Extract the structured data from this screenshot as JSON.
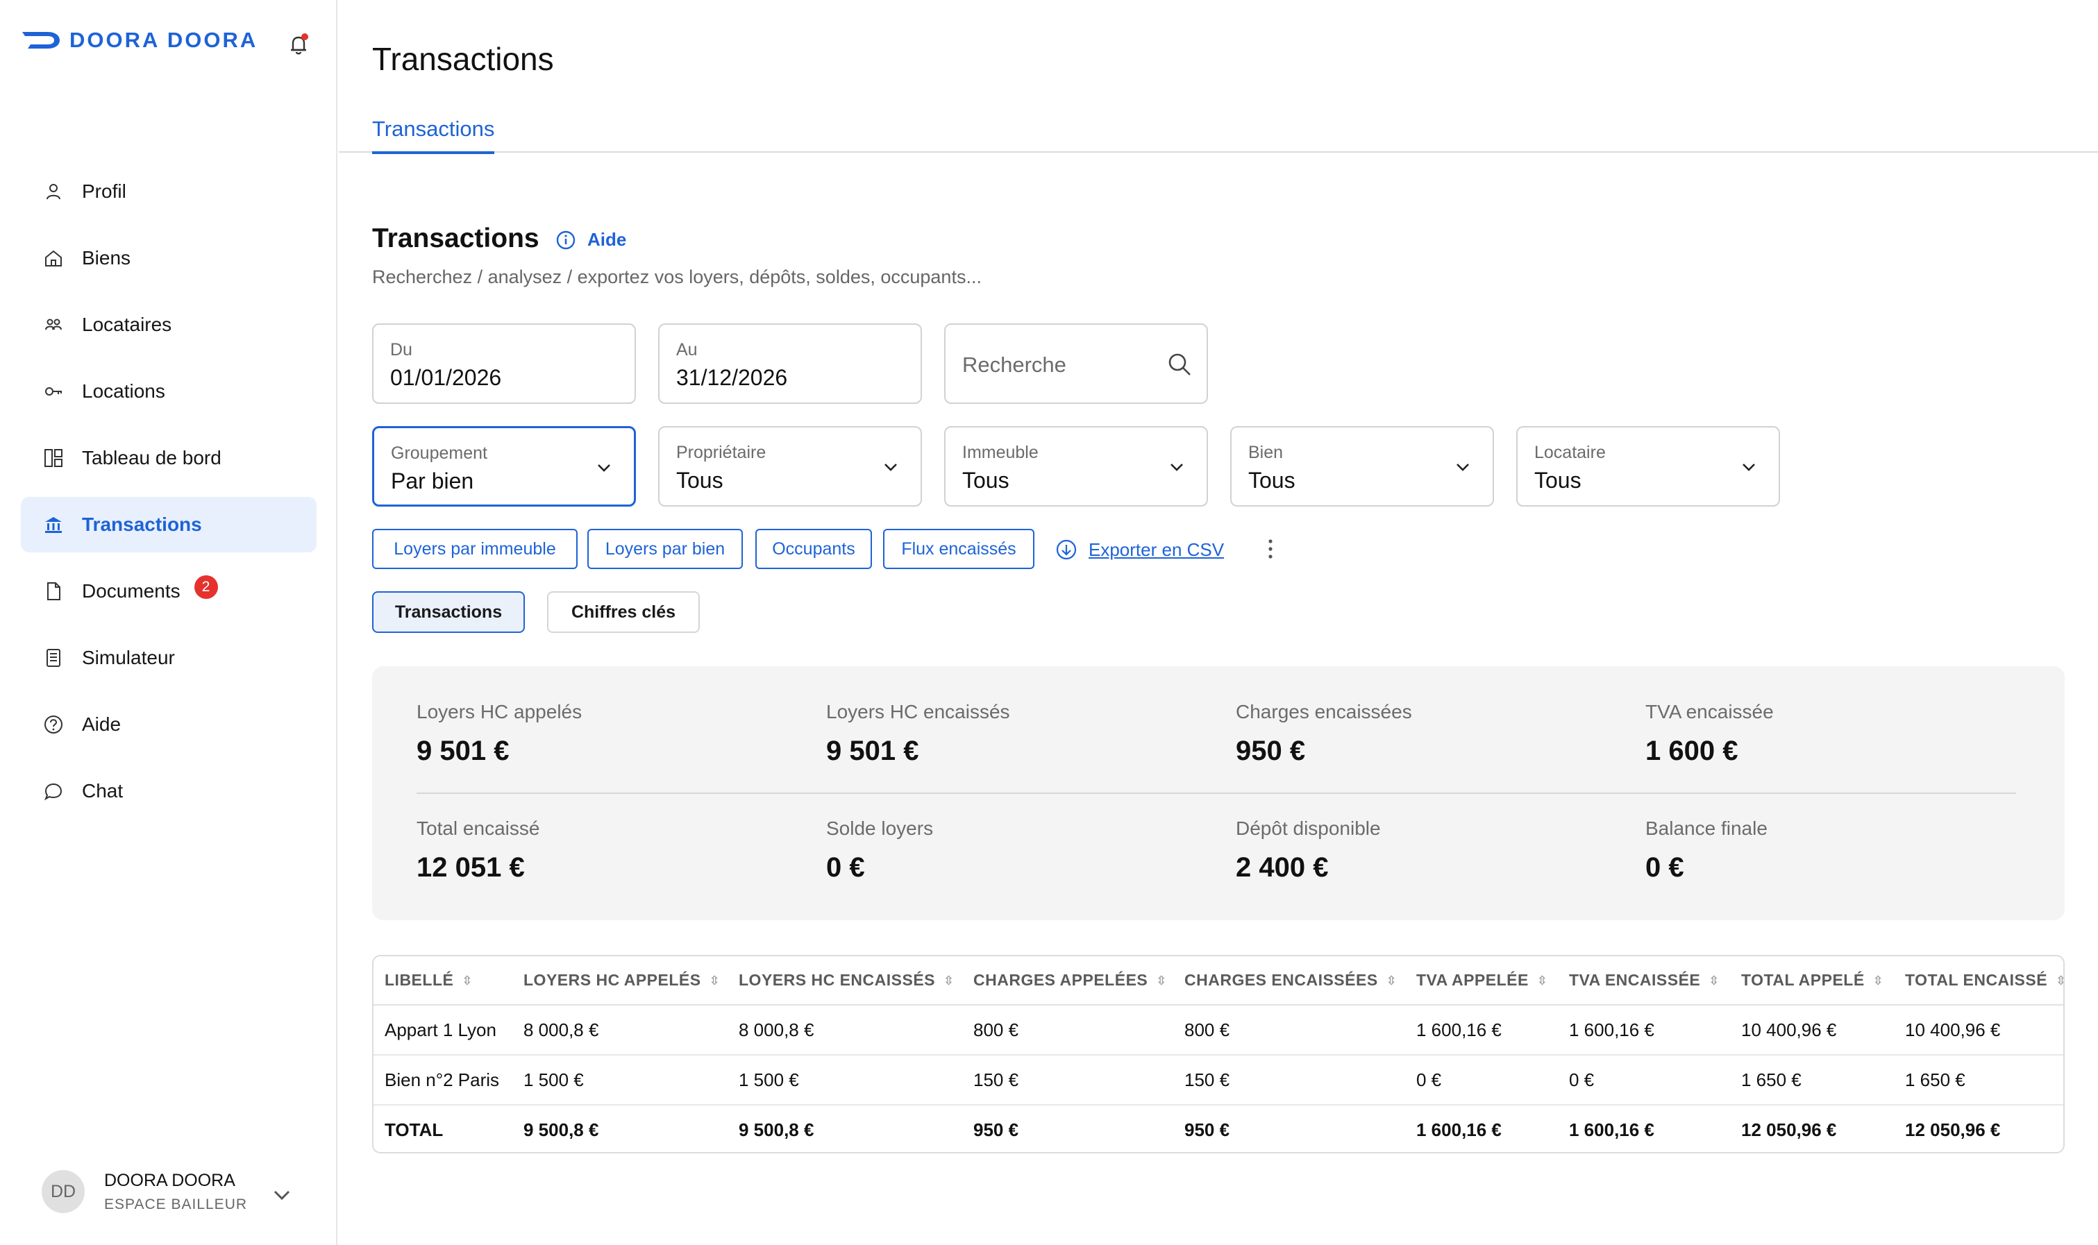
{
  "brand": {
    "name": "DOORA DOORA",
    "color": "#1e63d6"
  },
  "sidebar": {
    "items": [
      {
        "label": "Profil",
        "icon": "user-icon"
      },
      {
        "label": "Biens",
        "icon": "home-icon"
      },
      {
        "label": "Locataires",
        "icon": "people-icon"
      },
      {
        "label": "Locations",
        "icon": "key-icon"
      },
      {
        "label": "Tableau de bord",
        "icon": "dashboard-icon"
      },
      {
        "label": "Transactions",
        "icon": "bank-icon",
        "active": true
      },
      {
        "label": "Documents",
        "icon": "document-icon",
        "badge": "2"
      },
      {
        "label": "Simulateur",
        "icon": "calculator-icon"
      },
      {
        "label": "Aide",
        "icon": "help-icon"
      },
      {
        "label": "Chat",
        "icon": "chat-icon"
      }
    ],
    "user": {
      "initials": "DD",
      "name": "DOORA DOORA",
      "role": "ESPACE BAILLEUR"
    }
  },
  "header": {
    "title": "Transactions",
    "tab": "Transactions"
  },
  "section": {
    "title": "Transactions",
    "help_label": "Aide",
    "subtitle": "Recherchez / analysez / exportez vos loyers, dépôts, soldes, occupants..."
  },
  "filters": {
    "from": {
      "label": "Du",
      "value": "01/01/2026"
    },
    "to": {
      "label": "Au",
      "value": "31/12/2026"
    },
    "search": {
      "placeholder": "Recherche"
    },
    "grouping": {
      "label": "Groupement",
      "value": "Par bien"
    },
    "owner": {
      "label": "Propriétaire",
      "value": "Tous"
    },
    "building": {
      "label": "Immeuble",
      "value": "Tous"
    },
    "property": {
      "label": "Bien",
      "value": "Tous"
    },
    "tenant": {
      "label": "Locataire",
      "value": "Tous"
    }
  },
  "quick_actions": {
    "chips": [
      "Loyers par immeuble",
      "Loyers par bien",
      "Occupants",
      "Flux encaissés"
    ],
    "export_label": "Exporter en CSV"
  },
  "view_toggle": {
    "transactions": "Transactions",
    "key_figures": "Chiffres clés"
  },
  "stats": [
    {
      "label": "Loyers HC appelés",
      "value": "9 501 €"
    },
    {
      "label": "Loyers HC encaissés",
      "value": "9 501 €"
    },
    {
      "label": "Charges encaissées",
      "value": "950 €"
    },
    {
      "label": "TVA encaissée",
      "value": "1 600 €"
    },
    {
      "label": "Total encaissé",
      "value": "12 051 €"
    },
    {
      "label": "Solde loyers",
      "value": "0 €"
    },
    {
      "label": "Dépôt disponible",
      "value": "2 400 €"
    },
    {
      "label": "Balance finale",
      "value": "0 €"
    }
  ],
  "table": {
    "columns": [
      "LIBELLÉ",
      "LOYERS HC APPELÉS",
      "LOYERS HC ENCAISSÉS",
      "CHARGES APPELÉES",
      "CHARGES ENCAISSÉES",
      "TVA APPELÉE",
      "TVA ENCAISSÉE",
      "TOTAL APPELÉ",
      "TOTAL ENCAISSÉ"
    ],
    "rows": [
      [
        "Appart 1 Lyon",
        "8 000,8 €",
        "8 000,8 €",
        "800 €",
        "800 €",
        "1 600,16 €",
        "1 600,16 €",
        "10 400,96 €",
        "10 400,96 €"
      ],
      [
        "Bien n°2 Paris",
        "1 500 €",
        "1 500 €",
        "150 €",
        "150 €",
        "0 €",
        "0 €",
        "1 650 €",
        "1 650 €"
      ]
    ],
    "total": [
      "TOTAL",
      "9 500,8 €",
      "9 500,8 €",
      "950 €",
      "950 €",
      "1 600,16 €",
      "1 600,16 €",
      "12 050,96 €",
      "12 050,96 €"
    ]
  }
}
